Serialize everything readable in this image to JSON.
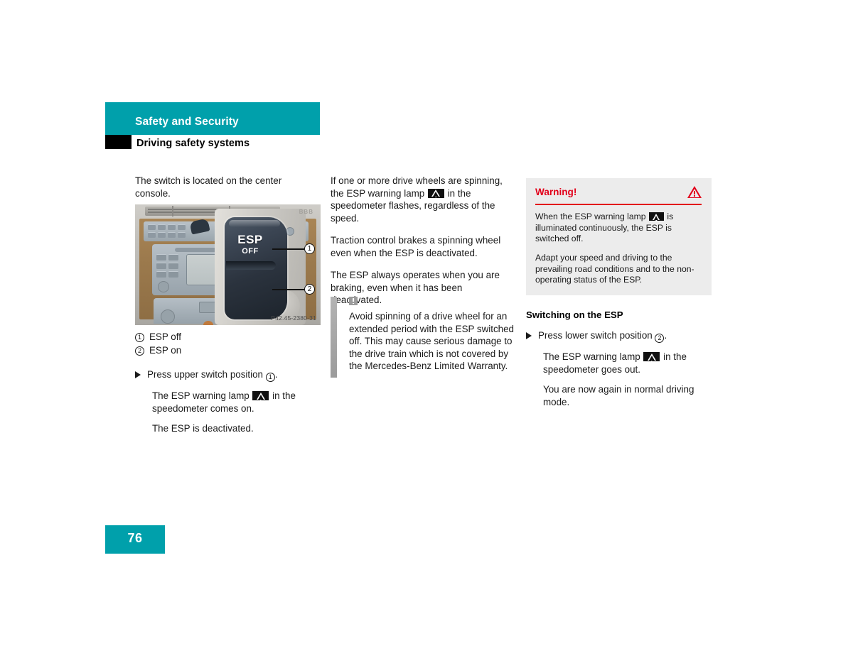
{
  "header": {
    "title": "Safety and Security",
    "subtitle": "Driving safety systems",
    "band_color": "#00A0AB",
    "tab_color": "#000000"
  },
  "left_column": {
    "intro": "The switch is located on the center console.",
    "figure": {
      "name": "center-console-esp-switch",
      "switch_label_top": "ESP",
      "switch_label_bottom": "OFF",
      "image_code": "P42.45-2380-31",
      "watermark": "BBB",
      "callouts": [
        {
          "number": "1",
          "label": "ESP off"
        },
        {
          "number": "2",
          "label": "ESP on"
        }
      ]
    },
    "legend": [
      {
        "number": "1",
        "text": "ESP off"
      },
      {
        "number": "2",
        "text": "ESP on"
      }
    ],
    "step": {
      "instruction_pre": "Press upper switch position ",
      "instruction_num": "1",
      "instruction_post": ".",
      "result_pre": "The ESP warning lamp ",
      "result_post": " in the speedometer comes on.",
      "result2": "The ESP is deactivated."
    }
  },
  "middle_column": {
    "paragraphs": [
      {
        "pre": "If one or more drive wheels are spinning, the ESP warning lamp ",
        "has_lamp": true,
        "post": " in the speedometer flashes, regardless of the speed."
      },
      {
        "pre": "Traction control brakes a spinning wheel even when the ESP is deactivated.",
        "has_lamp": false,
        "post": ""
      },
      {
        "pre": "The ESP always operates when you are braking, even when it has been deactivated.",
        "has_lamp": false,
        "post": ""
      }
    ],
    "note": {
      "icon": "exclamation-note-icon",
      "text": "Avoid spinning of a drive wheel for an extended period with the ESP switched off. This may cause serious damage to the drive train which is not covered by the Mercedes-Benz Limited Warranty."
    }
  },
  "right_column": {
    "warning": {
      "title": "Warning!",
      "title_color": "#E2001A",
      "background": "#ececec",
      "paragraph_1_pre": "When the ESP warning lamp ",
      "paragraph_1_post": " is illuminated continuously, the ESP is switched off.",
      "paragraph_2": "Adapt your speed and driving to the prevailing road conditions and to the non-operating status of the ESP."
    },
    "section": {
      "title": "Switching on the ESP",
      "instruction_pre": "Press lower switch position ",
      "instruction_num": "2",
      "instruction_post": ".",
      "result_pre": "The ESP warning lamp ",
      "result_post": " in the speedometer goes out.",
      "result2": "You are now again in normal driving mode."
    }
  },
  "footer": {
    "page_number": "76",
    "box_color": "#00A0AB"
  }
}
